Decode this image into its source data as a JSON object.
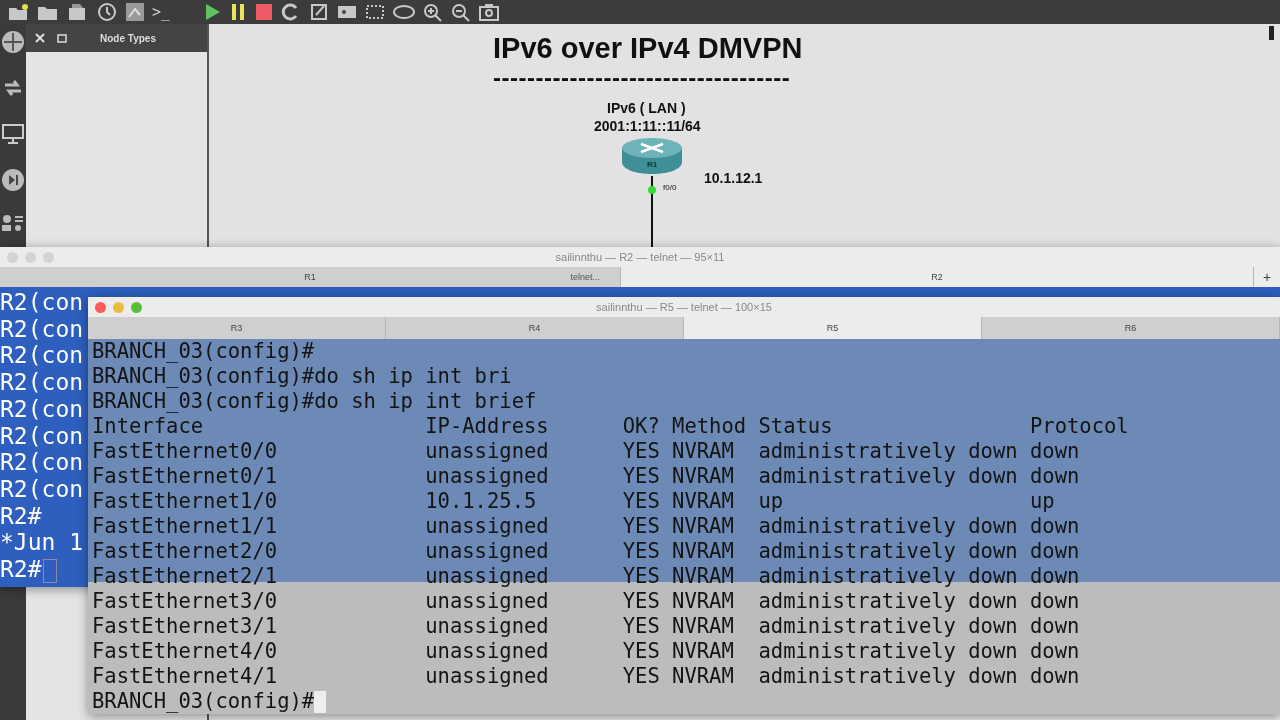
{
  "toolbar": {
    "console_glyph": ">_"
  },
  "node_types_panel": {
    "title": "Node Types"
  },
  "canvas": {
    "title": "IPv6 over IPv4 DMVPN",
    "underline": "-----------------------------------",
    "lan_label": "IPv6 ( LAN )",
    "lan_address": "2001:1:11::11/64",
    "router": {
      "name": "R1",
      "port": "f0/0",
      "port_up": true,
      "address": "10.1.12.1"
    }
  },
  "r2_terminal": {
    "title": "sailinnthu — R2 — telnet — 95×11",
    "add_tab": "+",
    "tabs": [
      {
        "label": "R1",
        "note": "telnet...",
        "selected": false
      },
      {
        "label": "R2",
        "selected": true
      }
    ],
    "lines": [
      "R2(con",
      "R2(con",
      "R2(con",
      "R2(con",
      "R2(con",
      "R2(con",
      "R2(con",
      "R2(con",
      "R2#",
      "*Jun 1",
      "R2#"
    ]
  },
  "r5_terminal": {
    "title": "sailinnthu — R5 — telnet — 100×15",
    "tabs": [
      {
        "label": "R3",
        "selected": false
      },
      {
        "label": "R4",
        "selected": false
      },
      {
        "label": "R5",
        "selected": true
      },
      {
        "label": "R6",
        "selected": false
      }
    ],
    "lines": [
      "BRANCH_03(config)#",
      "BRANCH_03(config)#do sh ip int bri",
      "BRANCH_03(config)#do sh ip int brief"
    ],
    "table": {
      "columns": [
        "Interface",
        "IP-Address",
        "OK?",
        "Method",
        "Status",
        "Protocol"
      ],
      "rows": [
        [
          "FastEthernet0/0",
          "unassigned",
          "YES",
          "NVRAM",
          "administratively down",
          "down"
        ],
        [
          "FastEthernet0/1",
          "unassigned",
          "YES",
          "NVRAM",
          "administratively down",
          "down"
        ],
        [
          "FastEthernet1/0",
          "10.1.25.5",
          "YES",
          "NVRAM",
          "up",
          "up"
        ],
        [
          "FastEthernet1/1",
          "unassigned",
          "YES",
          "NVRAM",
          "administratively down",
          "down"
        ],
        [
          "FastEthernet2/0",
          "unassigned",
          "YES",
          "NVRAM",
          "administratively down",
          "down"
        ],
        [
          "FastEthernet2/1",
          "unassigned",
          "YES",
          "NVRAM",
          "administratively down",
          "down"
        ],
        [
          "FastEthernet3/0",
          "unassigned",
          "YES",
          "NVRAM",
          "administratively down",
          "down"
        ],
        [
          "FastEthernet3/1",
          "unassigned",
          "YES",
          "NVRAM",
          "administratively down",
          "down"
        ],
        [
          "FastEthernet4/0",
          "unassigned",
          "YES",
          "NVRAM",
          "administratively down",
          "down"
        ],
        [
          "FastEthernet4/1",
          "unassigned",
          "YES",
          "NVRAM",
          "administratively down",
          "down"
        ]
      ]
    },
    "prompt": "BRANCH_03(config)#"
  }
}
